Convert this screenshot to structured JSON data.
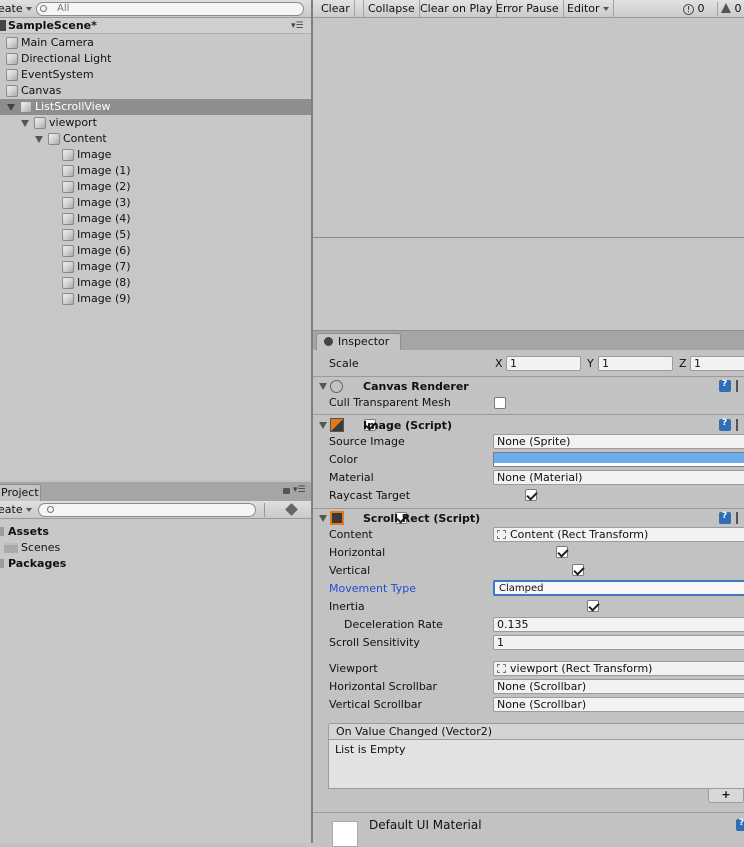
{
  "hierarchy": {
    "create_label": "eate",
    "search_placeholder": "All",
    "scene_name": "SampleScene*",
    "items": [
      {
        "label": "Main Camera"
      },
      {
        "label": "Directional Light"
      },
      {
        "label": "EventSystem"
      },
      {
        "label": "Canvas"
      },
      {
        "label": "ListScrollView"
      },
      {
        "label": "viewport"
      },
      {
        "label": "Content"
      },
      {
        "label": "Image"
      },
      {
        "label": "Image (1)"
      },
      {
        "label": "Image (2)"
      },
      {
        "label": "Image (3)"
      },
      {
        "label": "Image (4)"
      },
      {
        "label": "Image (5)"
      },
      {
        "label": "Image (6)"
      },
      {
        "label": "Image (7)"
      },
      {
        "label": "Image (8)"
      },
      {
        "label": "Image (9)"
      }
    ]
  },
  "console": {
    "clear": "Clear",
    "collapse": "Collapse",
    "clear_on_play": "Clear on Play",
    "error_pause": "Error Pause",
    "editor": "Editor",
    "count_1": "0",
    "count_2": "0"
  },
  "inspector": {
    "tab_label": "Inspector",
    "scale_label": "Scale",
    "scale_x_label": "X",
    "scale_x": "1",
    "scale_y_label": "Y",
    "scale_y": "1",
    "scale_z_label": "Z",
    "scale_z": "1",
    "canvas_renderer": {
      "title": "Canvas Renderer",
      "cull_label": "Cull Transparent Mesh",
      "cull_checked": false
    },
    "image": {
      "title": "Image (Script)",
      "source_image_label": "Source Image",
      "source_image_value": "None (Sprite)",
      "color_label": "Color",
      "color_value": "#6aaeee",
      "material_label": "Material",
      "material_value": "None (Material)",
      "raycast_label": "Raycast Target"
    },
    "scroll_rect": {
      "title": "Scroll Rect (Script)",
      "content_label": "Content",
      "content_value": "Content (Rect Transform)",
      "horizontal_label": "Horizontal",
      "vertical_label": "Vertical",
      "movement_type_label": "Movement Type",
      "movement_type_value": "Clamped",
      "inertia_label": "Inertia",
      "deceleration_label": "Deceleration Rate",
      "deceleration_value": "0.135",
      "scroll_sensitivity_label": "Scroll Sensitivity",
      "scroll_sensitivity_value": "1",
      "viewport_label": "Viewport",
      "viewport_value": "viewport (Rect Transform)",
      "h_scrollbar_label": "Horizontal Scrollbar",
      "h_scrollbar_value": "None (Scrollbar)",
      "v_scrollbar_label": "Vertical Scrollbar",
      "v_scrollbar_value": "None (Scrollbar)",
      "event_title": "On Value Changed (Vector2)",
      "event_empty": "List is Empty",
      "event_add": "+"
    },
    "material": {
      "title": "Default UI Material"
    }
  },
  "project": {
    "tab_label": "Project",
    "create_label": "eate",
    "items": [
      {
        "label": "Assets"
      },
      {
        "label": "Scenes"
      },
      {
        "label": "Packages"
      }
    ]
  }
}
